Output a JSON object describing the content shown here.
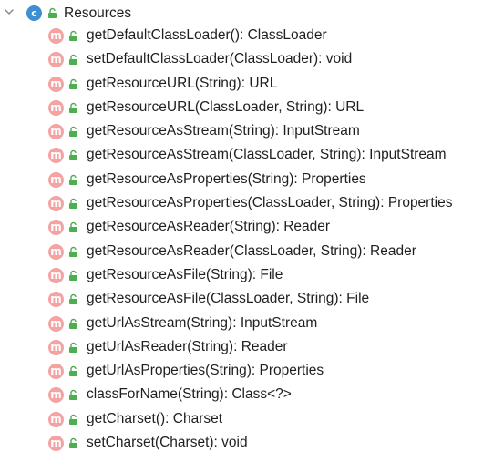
{
  "tree": {
    "class_node": {
      "icon_letter": "c",
      "name": "Resources",
      "expanded": true
    },
    "methods": [
      {
        "icon_letter": "m",
        "signature": "getDefaultClassLoader(): ClassLoader"
      },
      {
        "icon_letter": "m",
        "signature": "setDefaultClassLoader(ClassLoader): void"
      },
      {
        "icon_letter": "m",
        "signature": "getResourceURL(String): URL"
      },
      {
        "icon_letter": "m",
        "signature": "getResourceURL(ClassLoader, String): URL"
      },
      {
        "icon_letter": "m",
        "signature": "getResourceAsStream(String): InputStream"
      },
      {
        "icon_letter": "m",
        "signature": "getResourceAsStream(ClassLoader, String): InputStream"
      },
      {
        "icon_letter": "m",
        "signature": "getResourceAsProperties(String): Properties"
      },
      {
        "icon_letter": "m",
        "signature": "getResourceAsProperties(ClassLoader, String): Properties"
      },
      {
        "icon_letter": "m",
        "signature": "getResourceAsReader(String): Reader"
      },
      {
        "icon_letter": "m",
        "signature": "getResourceAsReader(ClassLoader, String): Reader"
      },
      {
        "icon_letter": "m",
        "signature": "getResourceAsFile(String): File"
      },
      {
        "icon_letter": "m",
        "signature": "getResourceAsFile(ClassLoader, String): File"
      },
      {
        "icon_letter": "m",
        "signature": "getUrlAsStream(String): InputStream"
      },
      {
        "icon_letter": "m",
        "signature": "getUrlAsReader(String): Reader"
      },
      {
        "icon_letter": "m",
        "signature": "getUrlAsProperties(String): Properties"
      },
      {
        "icon_letter": "m",
        "signature": "classForName(String): Class<?>"
      },
      {
        "icon_letter": "m",
        "signature": "getCharset(): Charset"
      },
      {
        "icon_letter": "m",
        "signature": "setCharset(Charset): void"
      }
    ]
  },
  "icons": {
    "expand": "chevron-down-icon",
    "class": "class-icon",
    "method": "method-icon",
    "visibility": "public-lock-icon"
  },
  "colors": {
    "class_icon": "#3d8ed2",
    "method_icon": "#f4a3a3",
    "lock_icon": "#4caf50",
    "text": "#1f1f1f",
    "chevron": "#8c8c8c"
  }
}
